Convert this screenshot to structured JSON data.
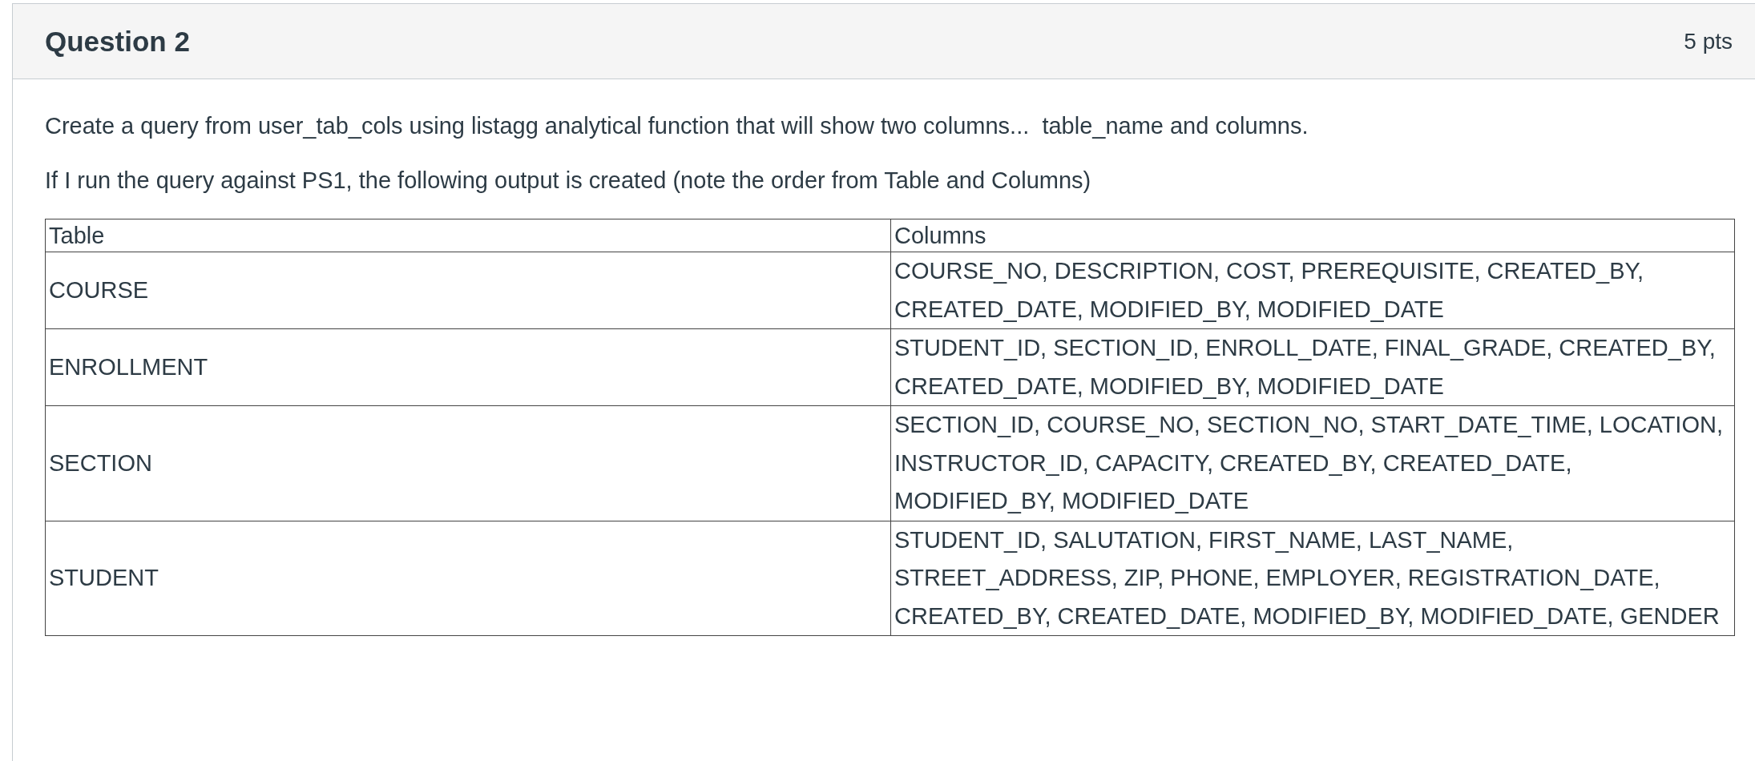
{
  "question": {
    "title": "Question 2",
    "points": "5 pts"
  },
  "paragraphs": [
    "Create a query from user_tab_cols using listagg analytical function that will show two columns...  table_name and columns.",
    "If I run the query against PS1, the following output is created (note the order from Table and Columns)"
  ],
  "table": {
    "columns": [
      "Table",
      "Columns"
    ],
    "rows": [
      {
        "table": "COURSE",
        "columns": "COURSE_NO, DESCRIPTION, COST, PREREQUISITE, CREATED_BY, CREATED_DATE, MODIFIED_BY, MODIFIED_DATE"
      },
      {
        "table": "ENROLLMENT",
        "columns": "STUDENT_ID, SECTION_ID, ENROLL_DATE, FINAL_GRADE, CREATED_BY, CREATED_DATE, MODIFIED_BY, MODIFIED_DATE"
      },
      {
        "table": "SECTION",
        "columns": "SECTION_ID, COURSE_NO, SECTION_NO, START_DATE_TIME, LOCATION, INSTRUCTOR_ID, CAPACITY, CREATED_BY, CREATED_DATE, MODIFIED_BY, MODIFIED_DATE"
      },
      {
        "table": "STUDENT",
        "columns": "STUDENT_ID, SALUTATION, FIRST_NAME, LAST_NAME, STREET_ADDRESS, ZIP, PHONE, EMPLOYER, REGISTRATION_DATE, CREATED_BY, CREATED_DATE, MODIFIED_BY, MODIFIED_DATE, GENDER"
      }
    ]
  }
}
